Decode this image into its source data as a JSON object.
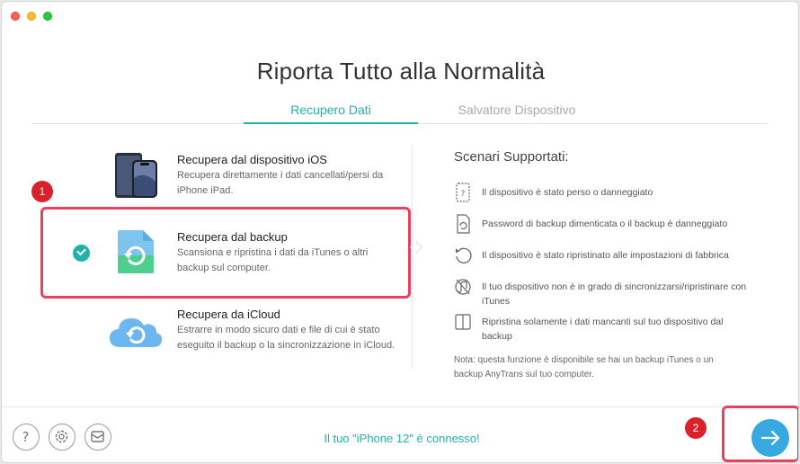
{
  "window": {
    "title": "Riporta Tutto alla Normalità"
  },
  "tabs": [
    {
      "label": "Recupero Dati",
      "active": true
    },
    {
      "label": "Salvatore Dispositivo",
      "active": false
    }
  ],
  "options": [
    {
      "title": "Recupera dal dispositivo iOS",
      "description": "Recupera direttamente i dati cancellati/persi da iPhone iPad.",
      "icon": "iphone-ipad-icon",
      "selected": false
    },
    {
      "title": "Recupera dal backup",
      "description": "Scansiona e ripristina i dati da iTunes o altri backup sul computer.",
      "icon": "backup-file-icon",
      "selected": true
    },
    {
      "title": "Recupera da iCloud",
      "description": "Estrarre in modo sicuro dati e file di cui è stato eseguito il backup o la sincronizzazione in iCloud.",
      "icon": "icloud-icon",
      "selected": false
    }
  ],
  "scenarios": {
    "title": "Scenari Supportati:",
    "items": [
      {
        "icon": "lost-device-icon",
        "text": "Il dispositivo è stato perso o danneggiato"
      },
      {
        "icon": "backup-password-icon",
        "text": "Password di backup dimenticata o il backup è danneggiato"
      },
      {
        "icon": "factory-reset-icon",
        "text": "Il dispositivo è stato ripristinato alle impostazioni di fabbrica"
      },
      {
        "icon": "sync-failed-icon",
        "text": "Il tuo dispositivo non è in grado di sincronizzarsi/ripristinare con iTunes"
      },
      {
        "icon": "partial-restore-icon",
        "text": "Ripristina solamente i dati mancanti sul tuo dispositivo dal backup"
      }
    ],
    "note": "Nota: questa funzione è disponibile se hai un backup iTunes o un backup AnyTrans sul tuo computer."
  },
  "annotations": {
    "badge_1": "1",
    "badge_2": "2"
  },
  "footer": {
    "status": "Il tuo \"iPhone 12\" è connesso!",
    "buttons": [
      "help-icon",
      "settings-icon",
      "mail-icon"
    ]
  },
  "colors": {
    "accent": "#1fb3a8",
    "highlight": "#e8405e",
    "badge": "#d9212b",
    "next": "#38a8e0"
  }
}
